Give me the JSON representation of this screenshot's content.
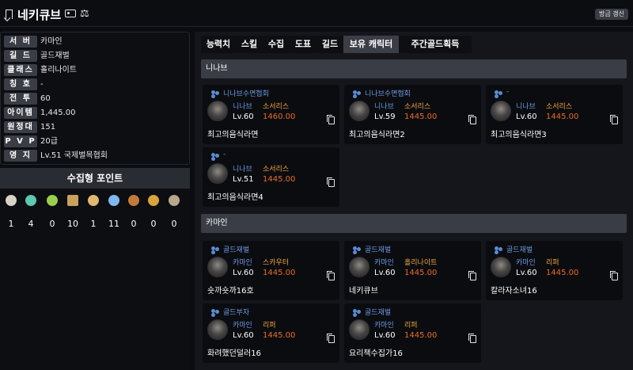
{
  "header": {
    "title": "네키큐브",
    "refresh_label": "방금 갱신"
  },
  "info": [
    {
      "label": "서 버",
      "value": "카마인"
    },
    {
      "label": "길 드",
      "value": "골드재벌"
    },
    {
      "label": "클래스",
      "value": "홀리나이트"
    },
    {
      "label": "칭 호",
      "value": "-"
    },
    {
      "label": "전 투",
      "value": "60"
    },
    {
      "label": "아이템",
      "value": "1,445.00"
    },
    {
      "label": "원정대",
      "value": "151"
    },
    {
      "label": "P V P",
      "value": "20급"
    },
    {
      "label": "영 지",
      "value": "Lv.51 국제벌목협회"
    }
  ],
  "collection": {
    "title": "수집형 포인트",
    "items": [
      {
        "icon": "mokoko-seed-icon",
        "count": "1"
      },
      {
        "icon": "island-heart-icon",
        "count": "4"
      },
      {
        "icon": "world-tree-leaf-icon",
        "count": "0"
      },
      {
        "icon": "adventure-map-icon",
        "count": "10"
      },
      {
        "icon": "ignea-token-icon",
        "count": "1"
      },
      {
        "icon": "orpheus-star-icon",
        "count": "11"
      },
      {
        "icon": "giant-heart-icon",
        "count": "0"
      },
      {
        "icon": "masterpiece-icon",
        "count": "0"
      },
      {
        "icon": "sea-bounty-icon",
        "count": "0"
      }
    ],
    "colors": [
      "#d9d3c7",
      "#5ec8b0",
      "#9bcf4c",
      "#c9a15b",
      "#e0b870",
      "#7fb9f0",
      "#c47a3d",
      "#d9a43a",
      "#b8a78a"
    ]
  },
  "tabs": [
    "능력치",
    "스킬",
    "수집",
    "도표",
    "길드",
    "보유 캐릭터",
    "주간골드획득"
  ],
  "active_tab": "보유 캐릭터",
  "sections": [
    {
      "name": "니나브",
      "characters": [
        {
          "guild": "니나브수면협회",
          "server": "니나브",
          "class": "소서리스",
          "level": "Lv.60",
          "ilvl": "1460.00",
          "name": "최고의음식라면"
        },
        {
          "guild": "니나브수면협회",
          "server": "니나브",
          "class": "소서리스",
          "level": "Lv.59",
          "ilvl": "1445.00",
          "name": "최고의음식라면2"
        },
        {
          "guild": "-",
          "server": "니나브",
          "class": "소서리스",
          "level": "Lv.60",
          "ilvl": "1445.00",
          "name": "최고의음식라면3"
        },
        {
          "guild": "-",
          "server": "니나브",
          "class": "소서리스",
          "level": "Lv.51",
          "ilvl": "1445.00",
          "name": "최고의음식라면4"
        }
      ]
    },
    {
      "name": "카마인",
      "characters": [
        {
          "guild": "골드재벌",
          "server": "카마인",
          "class": "스카우터",
          "level": "Lv.60",
          "ilvl": "1445.00",
          "name": "숏까숏까16호"
        },
        {
          "guild": "골드재벌",
          "server": "카마인",
          "class": "홀리나이트",
          "level": "Lv.60",
          "ilvl": "1445.00",
          "name": "네키큐브"
        },
        {
          "guild": "골드재벌",
          "server": "카마인",
          "class": "리퍼",
          "level": "Lv.60",
          "ilvl": "1445.00",
          "name": "칼라자소녀16"
        },
        {
          "guild": "골드부자",
          "server": "카마인",
          "class": "리퍼",
          "level": "Lv.60",
          "ilvl": "1445.00",
          "name": "화려했던덜러16"
        },
        {
          "guild": "골드재벌",
          "server": "카마인",
          "class": "리퍼",
          "level": "Lv.60",
          "ilvl": "1445.00",
          "name": "요리책수집가16"
        }
      ]
    }
  ]
}
